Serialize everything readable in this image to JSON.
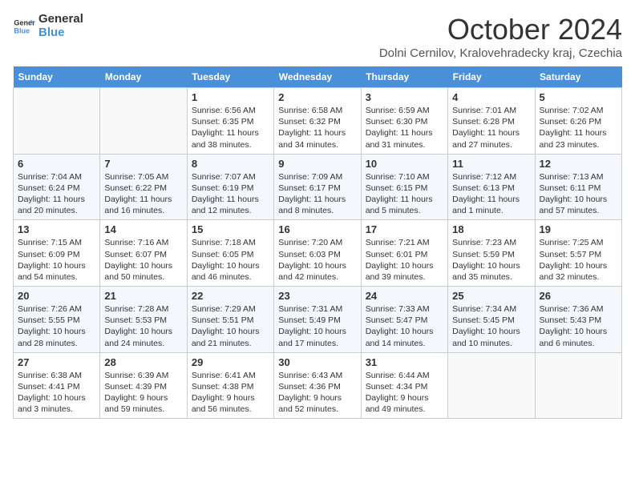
{
  "header": {
    "logo_line1": "General",
    "logo_line2": "Blue",
    "month_title": "October 2024",
    "location": "Dolni Cernilov, Kralovehradecky kraj, Czechia"
  },
  "days_of_week": [
    "Sunday",
    "Monday",
    "Tuesday",
    "Wednesday",
    "Thursday",
    "Friday",
    "Saturday"
  ],
  "weeks": [
    [
      {
        "day": "",
        "info": ""
      },
      {
        "day": "",
        "info": ""
      },
      {
        "day": "1",
        "info": "Sunrise: 6:56 AM\nSunset: 6:35 PM\nDaylight: 11 hours and 38 minutes."
      },
      {
        "day": "2",
        "info": "Sunrise: 6:58 AM\nSunset: 6:32 PM\nDaylight: 11 hours and 34 minutes."
      },
      {
        "day": "3",
        "info": "Sunrise: 6:59 AM\nSunset: 6:30 PM\nDaylight: 11 hours and 31 minutes."
      },
      {
        "day": "4",
        "info": "Sunrise: 7:01 AM\nSunset: 6:28 PM\nDaylight: 11 hours and 27 minutes."
      },
      {
        "day": "5",
        "info": "Sunrise: 7:02 AM\nSunset: 6:26 PM\nDaylight: 11 hours and 23 minutes."
      }
    ],
    [
      {
        "day": "6",
        "info": "Sunrise: 7:04 AM\nSunset: 6:24 PM\nDaylight: 11 hours and 20 minutes."
      },
      {
        "day": "7",
        "info": "Sunrise: 7:05 AM\nSunset: 6:22 PM\nDaylight: 11 hours and 16 minutes."
      },
      {
        "day": "8",
        "info": "Sunrise: 7:07 AM\nSunset: 6:19 PM\nDaylight: 11 hours and 12 minutes."
      },
      {
        "day": "9",
        "info": "Sunrise: 7:09 AM\nSunset: 6:17 PM\nDaylight: 11 hours and 8 minutes."
      },
      {
        "day": "10",
        "info": "Sunrise: 7:10 AM\nSunset: 6:15 PM\nDaylight: 11 hours and 5 minutes."
      },
      {
        "day": "11",
        "info": "Sunrise: 7:12 AM\nSunset: 6:13 PM\nDaylight: 11 hours and 1 minute."
      },
      {
        "day": "12",
        "info": "Sunrise: 7:13 AM\nSunset: 6:11 PM\nDaylight: 10 hours and 57 minutes."
      }
    ],
    [
      {
        "day": "13",
        "info": "Sunrise: 7:15 AM\nSunset: 6:09 PM\nDaylight: 10 hours and 54 minutes."
      },
      {
        "day": "14",
        "info": "Sunrise: 7:16 AM\nSunset: 6:07 PM\nDaylight: 10 hours and 50 minutes."
      },
      {
        "day": "15",
        "info": "Sunrise: 7:18 AM\nSunset: 6:05 PM\nDaylight: 10 hours and 46 minutes."
      },
      {
        "day": "16",
        "info": "Sunrise: 7:20 AM\nSunset: 6:03 PM\nDaylight: 10 hours and 42 minutes."
      },
      {
        "day": "17",
        "info": "Sunrise: 7:21 AM\nSunset: 6:01 PM\nDaylight: 10 hours and 39 minutes."
      },
      {
        "day": "18",
        "info": "Sunrise: 7:23 AM\nSunset: 5:59 PM\nDaylight: 10 hours and 35 minutes."
      },
      {
        "day": "19",
        "info": "Sunrise: 7:25 AM\nSunset: 5:57 PM\nDaylight: 10 hours and 32 minutes."
      }
    ],
    [
      {
        "day": "20",
        "info": "Sunrise: 7:26 AM\nSunset: 5:55 PM\nDaylight: 10 hours and 28 minutes."
      },
      {
        "day": "21",
        "info": "Sunrise: 7:28 AM\nSunset: 5:53 PM\nDaylight: 10 hours and 24 minutes."
      },
      {
        "day": "22",
        "info": "Sunrise: 7:29 AM\nSunset: 5:51 PM\nDaylight: 10 hours and 21 minutes."
      },
      {
        "day": "23",
        "info": "Sunrise: 7:31 AM\nSunset: 5:49 PM\nDaylight: 10 hours and 17 minutes."
      },
      {
        "day": "24",
        "info": "Sunrise: 7:33 AM\nSunset: 5:47 PM\nDaylight: 10 hours and 14 minutes."
      },
      {
        "day": "25",
        "info": "Sunrise: 7:34 AM\nSunset: 5:45 PM\nDaylight: 10 hours and 10 minutes."
      },
      {
        "day": "26",
        "info": "Sunrise: 7:36 AM\nSunset: 5:43 PM\nDaylight: 10 hours and 6 minutes."
      }
    ],
    [
      {
        "day": "27",
        "info": "Sunrise: 6:38 AM\nSunset: 4:41 PM\nDaylight: 10 hours and 3 minutes."
      },
      {
        "day": "28",
        "info": "Sunrise: 6:39 AM\nSunset: 4:39 PM\nDaylight: 9 hours and 59 minutes."
      },
      {
        "day": "29",
        "info": "Sunrise: 6:41 AM\nSunset: 4:38 PM\nDaylight: 9 hours and 56 minutes."
      },
      {
        "day": "30",
        "info": "Sunrise: 6:43 AM\nSunset: 4:36 PM\nDaylight: 9 hours and 52 minutes."
      },
      {
        "day": "31",
        "info": "Sunrise: 6:44 AM\nSunset: 4:34 PM\nDaylight: 9 hours and 49 minutes."
      },
      {
        "day": "",
        "info": ""
      },
      {
        "day": "",
        "info": ""
      }
    ]
  ]
}
